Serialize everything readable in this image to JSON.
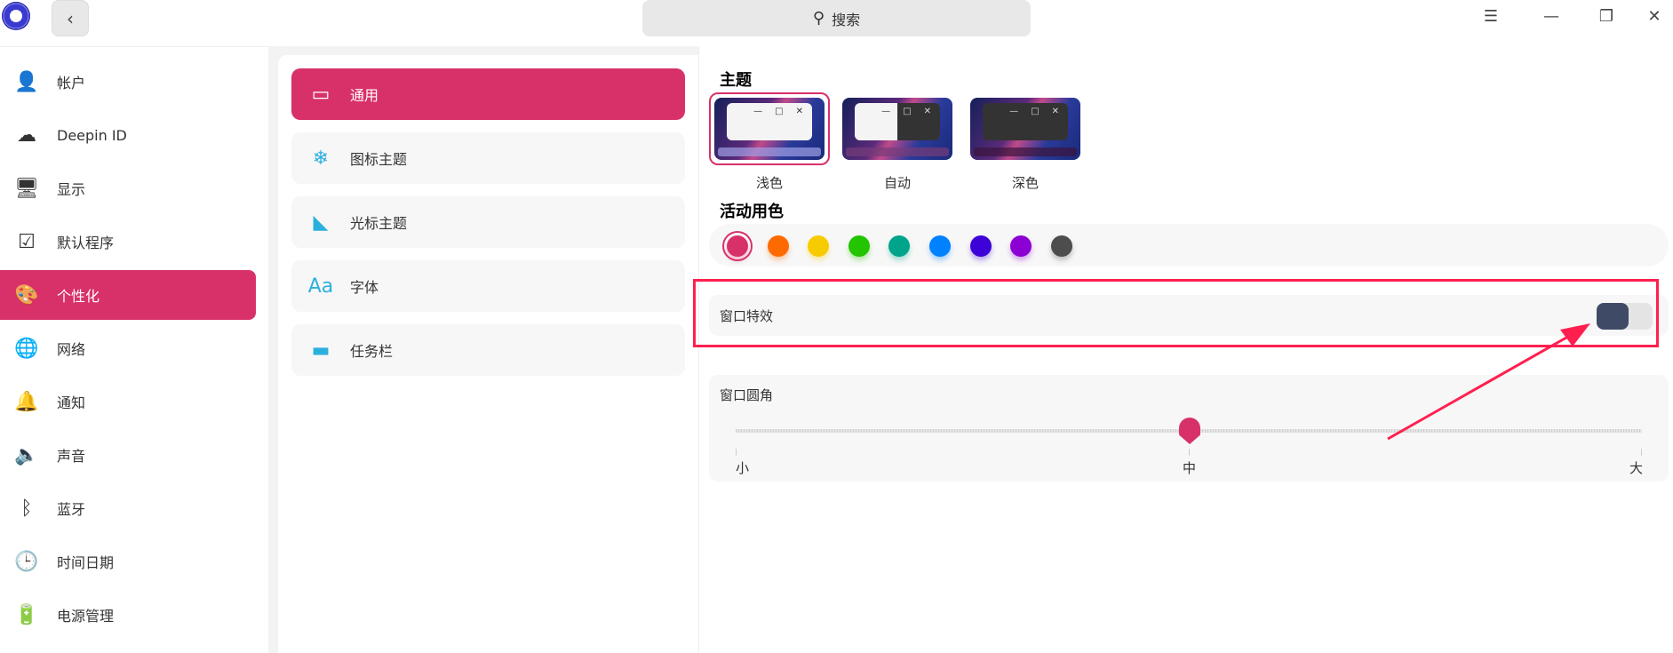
{
  "header": {
    "search_label": "搜索",
    "back_icon": "chevron-left",
    "menu_icon": "☰",
    "minimize_icon": "—",
    "maximize_icon": "❐",
    "close_icon": "✕"
  },
  "sidebar": {
    "items": [
      {
        "label": "帐户",
        "icon": "👤"
      },
      {
        "label": "Deepin ID",
        "icon": "☁"
      },
      {
        "label": "显示",
        "icon": "🖥"
      },
      {
        "label": "默认程序",
        "icon": "☑"
      },
      {
        "label": "个性化",
        "icon": "🎨",
        "active": true
      },
      {
        "label": "网络",
        "icon": "🌐"
      },
      {
        "label": "通知",
        "icon": "🔔"
      },
      {
        "label": "声音",
        "icon": "🔈"
      },
      {
        "label": "蓝牙",
        "icon": "ᛒ"
      },
      {
        "label": "时间日期",
        "icon": "🕒"
      },
      {
        "label": "电源管理",
        "icon": "🔋"
      }
    ]
  },
  "subnav": {
    "items": [
      {
        "label": "通用",
        "icon": "▭",
        "active": true
      },
      {
        "label": "图标主题",
        "icon": "❄"
      },
      {
        "label": "光标主题",
        "icon": "◣"
      },
      {
        "label": "字体",
        "icon": "Aa"
      },
      {
        "label": "任务栏",
        "icon": "▬"
      }
    ]
  },
  "theme": {
    "title": "主题",
    "options": [
      {
        "label": "浅色",
        "selected": true
      },
      {
        "label": "自动"
      },
      {
        "label": "深色"
      }
    ]
  },
  "accent": {
    "title": "活动用色",
    "colors": [
      "#d8316a",
      "#ff6a00",
      "#f8cb00",
      "#23c400",
      "#00a48a",
      "#0081ff",
      "#3c02d7",
      "#8c00d4",
      "#4d4d4d"
    ],
    "selected": 0
  },
  "window_effect": {
    "label": "窗口特效",
    "enabled": false
  },
  "corner": {
    "label": "窗口圆角",
    "ticks": [
      "小",
      "中",
      "大"
    ],
    "value_index": 1
  }
}
